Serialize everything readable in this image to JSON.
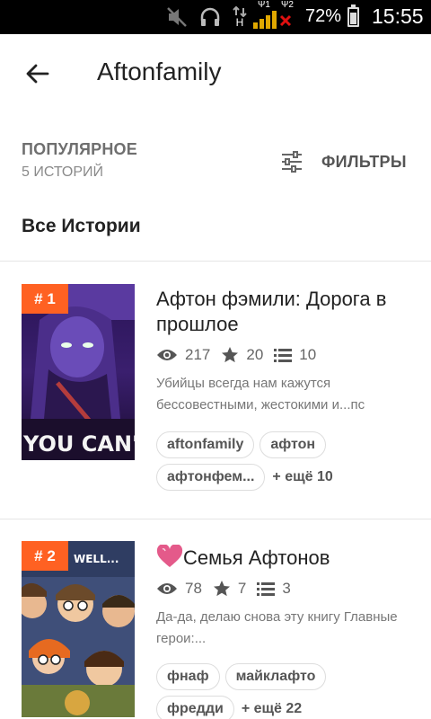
{
  "status_bar": {
    "battery_percent": "72%",
    "battery_level": 0.72,
    "time": "15:55",
    "icons": [
      "muted-icon",
      "headphones-icon",
      "data-transfer-icon",
      "signal-sim1-icon",
      "signal-sim2-no-service-icon",
      "battery-icon"
    ],
    "network_type": "H",
    "sim1_label": "Ψ1",
    "sim2_label": "Ψ2"
  },
  "header": {
    "back_icon": "arrow-left-icon",
    "title": "Aftonfamily"
  },
  "sort": {
    "label": "ПОПУЛЯРНОЕ",
    "count": "5 ИСТОРИЙ"
  },
  "filters": {
    "icon": "sliders-icon",
    "label": "ФИЛЬТРЫ"
  },
  "section_title": "Все Истории",
  "colors": {
    "accent": "#ff6122",
    "heart": "#e45a8a",
    "text": "#222222",
    "muted": "#777777"
  },
  "stories": [
    {
      "rank": "# 1",
      "title": "Афтон фэмили: Дорога в прошлое",
      "reads": "217",
      "votes": "20",
      "parts": "10",
      "description": "Убийцы всегда нам кажутся бессовестными, жестокими и...пс",
      "cover_text": "YOU CAN'T",
      "tags": [
        "aftonfamily",
        "афтон",
        "афтонфем..."
      ],
      "more_tags": "+ ещё 10"
    },
    {
      "rank": "# 2",
      "title_icon": "heart-icon",
      "title": "Семья Афтонов",
      "reads": "78",
      "votes": "7",
      "parts": "3",
      "description": "Да-да, делаю снова эту книгу Главные герои:...",
      "cover_text": "WELL...",
      "tags": [
        "фнаф",
        "майклафто",
        "фредди"
      ],
      "more_tags": "+ ещё 22"
    }
  ]
}
